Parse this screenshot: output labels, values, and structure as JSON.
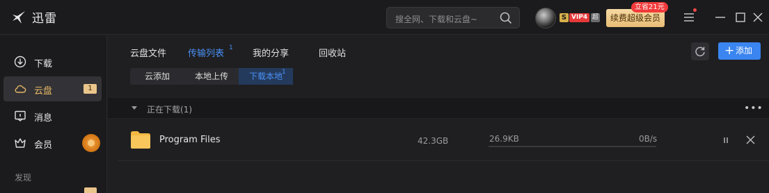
{
  "app": {
    "title": "迅雷",
    "logo_icon": "thunder-bird-icon"
  },
  "search": {
    "placeholder": "搜全网、下载和云盘~"
  },
  "account": {
    "vip_s": "S",
    "vip_level": "VIP4",
    "vip_tag": "超",
    "renew_label": "续费超级会员",
    "promo_label": "立省21元"
  },
  "sidebar": {
    "items": [
      {
        "label": "下载",
        "icon": "download-icon"
      },
      {
        "label": "云盘",
        "icon": "cloud-icon",
        "badge": "1"
      },
      {
        "label": "消息",
        "icon": "message-icon"
      },
      {
        "label": "会员",
        "icon": "crown-icon"
      }
    ],
    "section_label": "发现"
  },
  "main": {
    "tabs": [
      {
        "label": "云盘文件"
      },
      {
        "label": "传输列表",
        "count": "1"
      },
      {
        "label": "我的分享"
      },
      {
        "label": "回收站"
      }
    ],
    "add_label": "添加",
    "segments": [
      {
        "label": "云添加"
      },
      {
        "label": "本地上传"
      },
      {
        "label": "下载本地",
        "count": "1"
      }
    ],
    "group": {
      "title": "正在下载(1)"
    },
    "rows": [
      {
        "name": "Program Files",
        "size": "42.3GB",
        "progress": "26.9KB",
        "progress_fraction": 0.0,
        "speed": "0B/s"
      }
    ]
  },
  "colors": {
    "accent": "#4a90f5",
    "gold": "#e7b865",
    "background": "#1f1f21"
  }
}
